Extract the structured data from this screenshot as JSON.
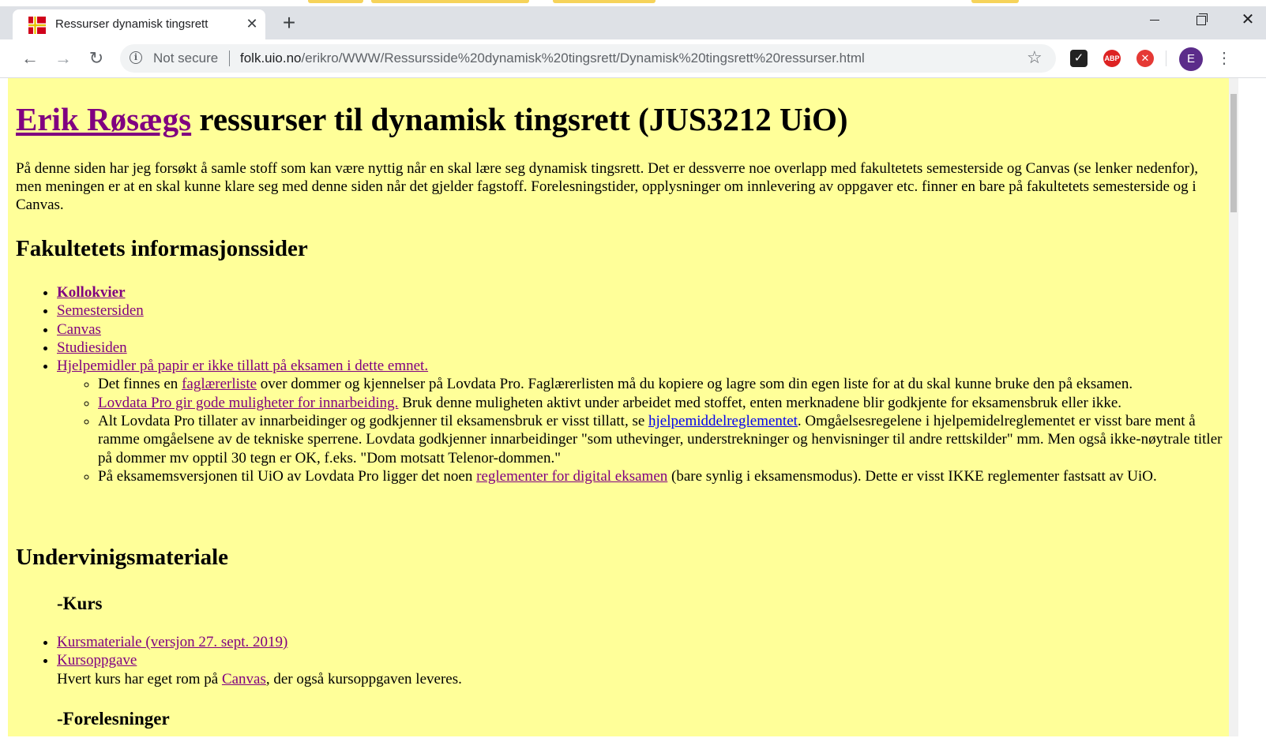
{
  "browser": {
    "tab_title": "Ressurser dynamisk tingsrett",
    "not_secure": "Not secure",
    "url_host": "folk.uio.no",
    "url_path": "/erikro/WWW/Ressursside%20dynamisk%20tingsrett/Dynamisk%20tingsrett%20ressurser.html",
    "avatar_letter": "E",
    "abp_label": "ABP"
  },
  "page": {
    "title_link": "Erik Røsægs",
    "title_rest": " ressurser til dynamisk tingsrett (JUS3212 UiO)",
    "intro": "På denne siden har jeg forsøkt å samle stoff som kan være nyttig når en skal lære seg dynamisk tingsrett. Det er dessverre noe overlapp med fakultetets semesterside og Canvas (se lenker nedenfor), men meningen er at en skal kunne klare seg med denne siden når det gjelder fagstoff. Forelesningstider, opplysninger om innlevering av oppgaver etc. finner en bare på fakultetets semesterside og i Canvas.",
    "section1_heading": "Fakultetets informasjonssider",
    "links": {
      "kollokvier": "Kollokvier",
      "semester": "Semestersiden",
      "canvas": "Canvas",
      "studie": "Studiesiden",
      "hjelpemidler": "Hjelpemidler på papir er ikke tillatt på eksamen i dette emnet."
    },
    "sub1": {
      "pre": "Det finnes en ",
      "link": "faglærerliste",
      "post": " over dommer og kjennelser på Lovdata Pro. Faglærerlisten må du kopiere og lagre som din egen liste for at du skal kunne bruke den på eksamen."
    },
    "sub2": {
      "link": "Lovdata Pro gir gode muligheter for innarbeiding.",
      "post": " Bruk denne muligheten aktivt under arbeidet med stoffet, enten merknadene blir godkjente for eksamensbruk eller ikke."
    },
    "sub3": {
      "pre": "Alt Lovdata Pro tillater av innarbeidinger og godkjenner til eksamensbruk er visst tillatt, se ",
      "link": "hjelpemiddelreglementet",
      "post": ". Omgåelsesregelene i hjelpemidelreglementet er visst bare ment å ramme omgåelsene av de tekniske sperrene. Lovdata godkjenner innarbeidinger \"som uthevinger, understrekninger og henvisninger til andre rettskilder\" mm. Men også ikke-nøytrale titler på dommer mv opptil 30 tegn er OK, f.eks. \"Dom motsatt Telenor-dommen.\""
    },
    "sub4": {
      "pre": "På eksamemsversjonen til UiO av Lovdata Pro ligger det noen ",
      "link": "reglementer for digital eksamen",
      "post": " (bare synlig i eksamensmodus). Dette er visst IKKE reglementer fastsatt av UiO."
    },
    "section2_heading": "Undervinigsmateriale",
    "kurs_heading": "-Kurs",
    "kurs": {
      "materiale": "Kursmateriale (versjon 27. sept. 2019)",
      "oppgave": "Kursoppgave",
      "note_pre": "Hvert kurs har eget rom på ",
      "note_link": "Canvas",
      "note_post": ", der også kursoppgaven leveres."
    },
    "forelesninger_heading": "-Forelesninger"
  }
}
